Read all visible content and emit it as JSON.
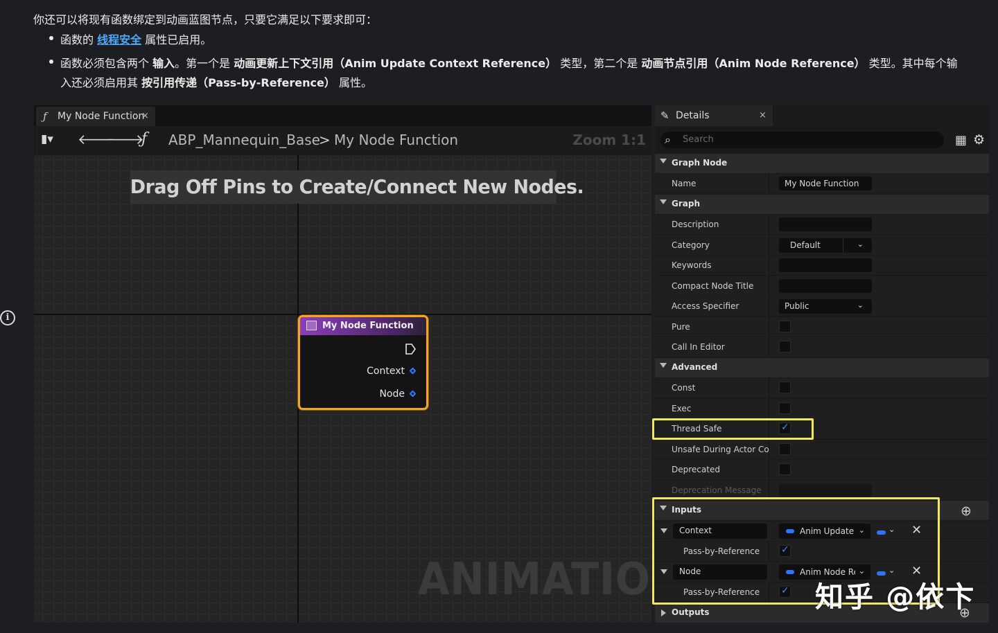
{
  "doc": {
    "intro": "你还可以将现有函数绑定到动画蓝图节点，只要它满足以下要求即可：",
    "bullet1_pre": "函数的",
    "bullet1_link": "线程安全",
    "bullet1_post": "属性已启用。",
    "bullet2_a": "函数必须包含两个",
    "bullet2_b": "输入",
    "bullet2_c": "。第一个是",
    "bullet2_d": "动画更新上下文引用（Anim Update Context Reference）",
    "bullet2_e": "类型，第二个是",
    "bullet2_f": "动画节点引用（Anim Node Reference）",
    "bullet2_g": "类型。其中每个输",
    "bullet2_h": "入还必须启用其",
    "bullet2_i": "按引用传递（Pass-by-Reference）",
    "bullet2_j": "属性。"
  },
  "editor": {
    "tab_label": "My Node Function",
    "tab_close": "×",
    "breadcrumb_root": "ABP_Mannequin_Base",
    "breadcrumb_sep": ">",
    "breadcrumb_leaf": "My Node Function",
    "zoom": "Zoom 1:1",
    "hint": "Drag Off Pins to Create/Connect New Nodes.",
    "watermark": "ANIMATION",
    "node": {
      "title": "My Node Function",
      "pins": [
        "Context",
        "Node"
      ]
    }
  },
  "details": {
    "tab_label": "Details",
    "tab_close": "×",
    "search_placeholder": "Search",
    "sections": {
      "graph_node": "Graph Node",
      "graph": "Graph",
      "advanced": "Advanced",
      "inputs": "Inputs",
      "outputs": "Outputs"
    },
    "name_label": "Name",
    "name_value": "My Node Function",
    "description_label": "Description",
    "category_label": "Category",
    "category_value": "Default",
    "keywords_label": "Keywords",
    "compact_title_label": "Compact Node Title",
    "access_label": "Access Specifier",
    "access_value": "Public",
    "pure_label": "Pure",
    "call_in_editor_label": "Call In Editor",
    "const_label": "Const",
    "exec_label": "Exec",
    "thread_safe_label": "Thread Safe",
    "unsafe_label": "Unsafe During Actor Cons",
    "deprecated_label": "Deprecated",
    "deprecation_msg_label": "Deprecation Message",
    "inputs": [
      {
        "name": "Context",
        "type": "Anim Update C",
        "pbr_label": "Pass-by-Reference",
        "pbr": true
      },
      {
        "name": "Node",
        "type": "Anim Node Re",
        "pbr_label": "Pass-by-Reference",
        "pbr": true
      }
    ],
    "checks": {
      "pure": false,
      "call_in_editor": false,
      "const": false,
      "exec": false,
      "thread_safe": true,
      "unsafe": false,
      "deprecated": false
    }
  },
  "watermark_credit": "知乎 @依卞",
  "colors": {
    "link": "#4aa8ff",
    "node_border": "#f4a423",
    "highlight": "#f3e85a",
    "pin": "#2f74ff"
  }
}
